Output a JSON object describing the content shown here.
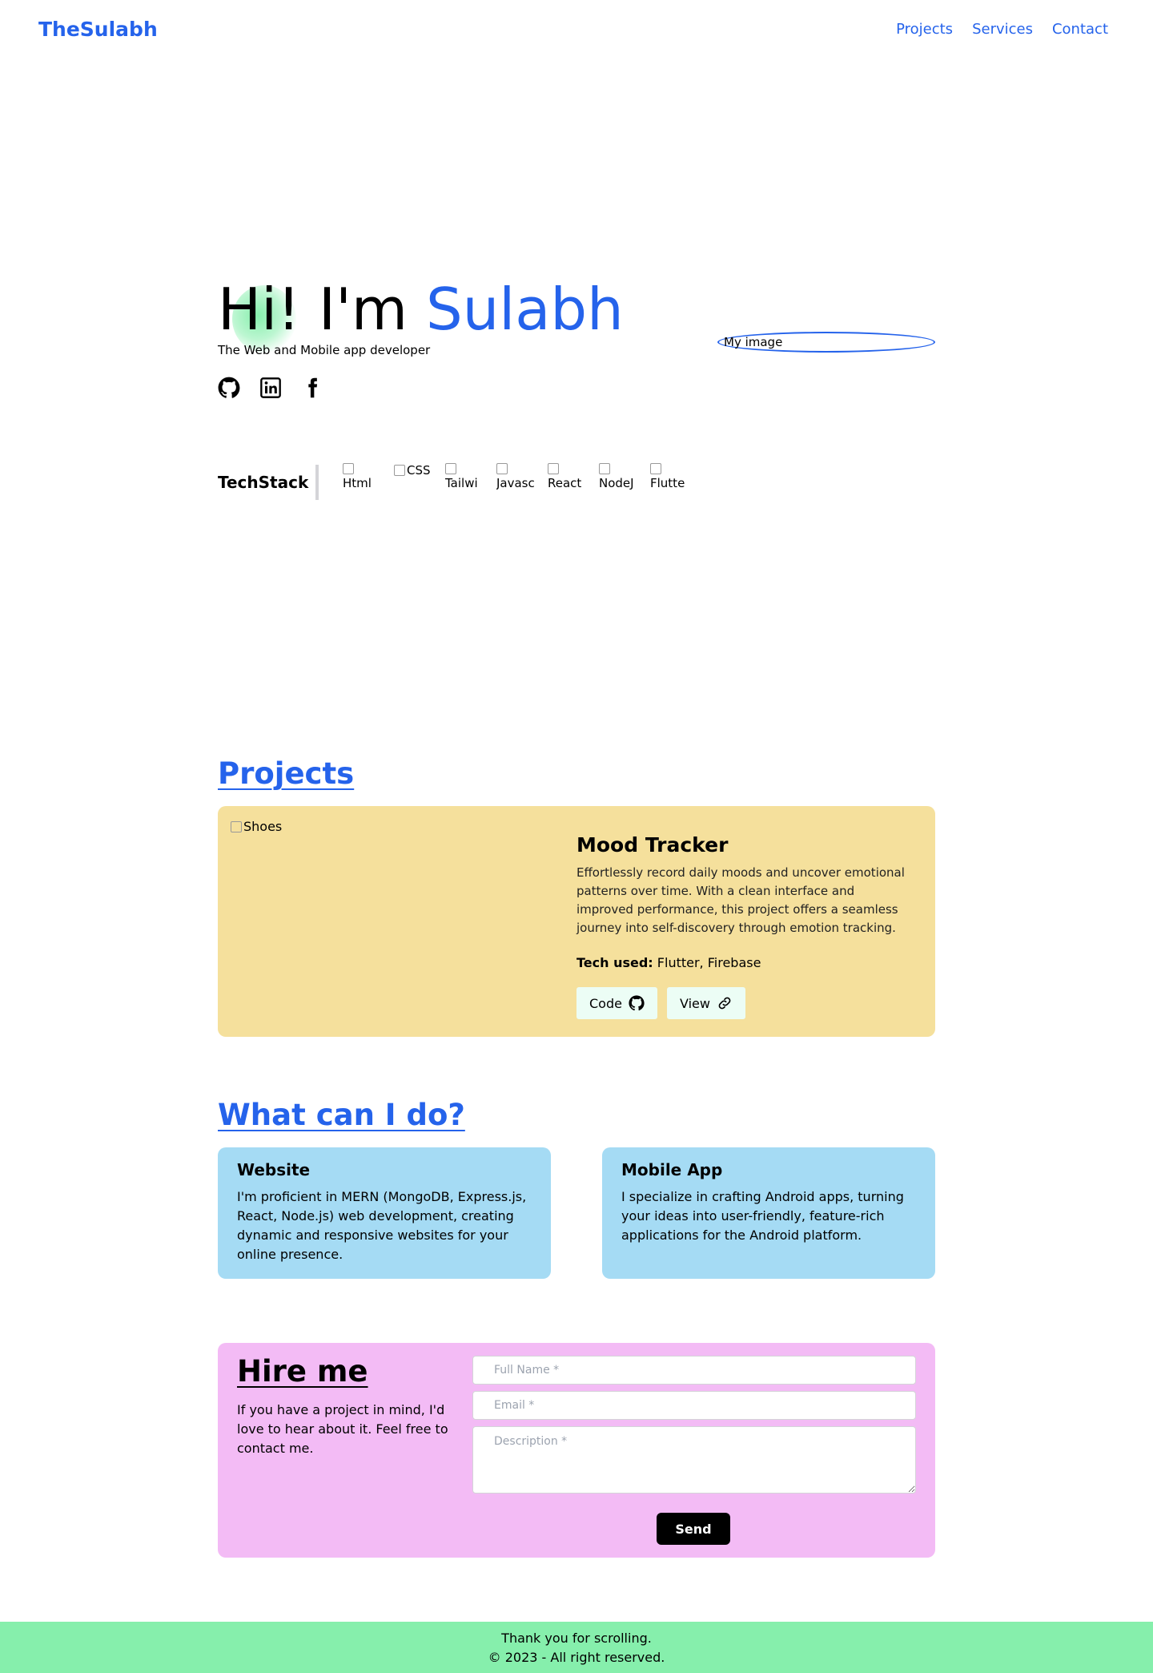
{
  "nav": {
    "brand": "TheSulabh",
    "links": [
      "Projects",
      "Services",
      "Contact"
    ]
  },
  "hero": {
    "greeting": "Hi! I'm ",
    "name": "Sulabh",
    "subtitle": "The Web and Mobile app developer",
    "image_alt": "My image",
    "socials": [
      "github-icon",
      "linkedin-icon",
      "facebook-icon"
    ]
  },
  "techstack": {
    "label": "TechStack",
    "items": [
      "Html",
      "CSS",
      "Tailwi",
      "Javasc",
      "React",
      "NodeJ",
      "Flutte"
    ]
  },
  "projects": {
    "title": "Projects",
    "items": [
      {
        "image_alt": "Shoes",
        "title": "Mood Tracker",
        "description": "Effortlessly record daily moods and uncover emotional patterns over time. With a clean interface and improved performance, this project offers a seamless journey into self-discovery through emotion tracking.",
        "tech_label": "Tech used:",
        "tech": "Flutter, Firebase",
        "code_label": "Code",
        "view_label": "View"
      }
    ]
  },
  "services": {
    "title": "What can I do?",
    "items": [
      {
        "title": "Website",
        "text": "I'm proficient in MERN (MongoDB, Express.js, React, Node.js) web development, creating dynamic and responsive websites for your online presence."
      },
      {
        "title": "Mobile App",
        "text": "I specialize in crafting Android apps, turning your ideas into user-friendly, feature-rich applications for the Android platform."
      }
    ]
  },
  "hire": {
    "title": "Hire me",
    "text": "If you have a project in mind, I'd love to hear about it. Feel free to contact me.",
    "name_placeholder": "Full Name *",
    "email_placeholder": "Email *",
    "description_placeholder": "Description *",
    "send_label": "Send"
  },
  "footer": {
    "line1": "Thank you for scrolling.",
    "line2": "© 2023 - All right reserved."
  },
  "colors": {
    "accent": "#2563eb",
    "project_card": "#f5e09c",
    "service_card": "#a5dbf4",
    "hire_card": "#f3bbf5",
    "footer": "#86efac"
  }
}
